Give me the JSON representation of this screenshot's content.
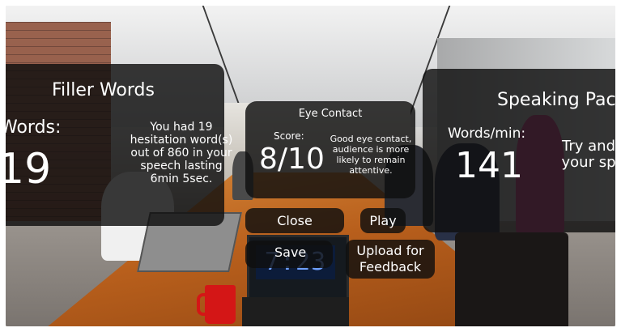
{
  "filler_panel": {
    "title": "Filler Words",
    "label": "Words:",
    "value": "19",
    "message": "You had 19 hesitation word(s) out of 860 in your speech lasting 6min 5sec."
  },
  "eye_panel": {
    "title": "Eye Contact",
    "label": "Score:",
    "value": "8/10",
    "message": "Good eye contact, audience is more likely to remain attentive."
  },
  "pace_panel": {
    "title": "Speaking Pace",
    "label": "Words/min:",
    "value": "141",
    "message": "Try and your sp"
  },
  "buttons": {
    "close": "Close",
    "play": "Play",
    "save": "Save",
    "upload": "Upload for Feedback"
  },
  "laptop_clock": "7:23",
  "colors": {
    "panel_bg": "#0f0f0f",
    "clock_text": "#6fa0ff",
    "mug": "#d41616"
  }
}
